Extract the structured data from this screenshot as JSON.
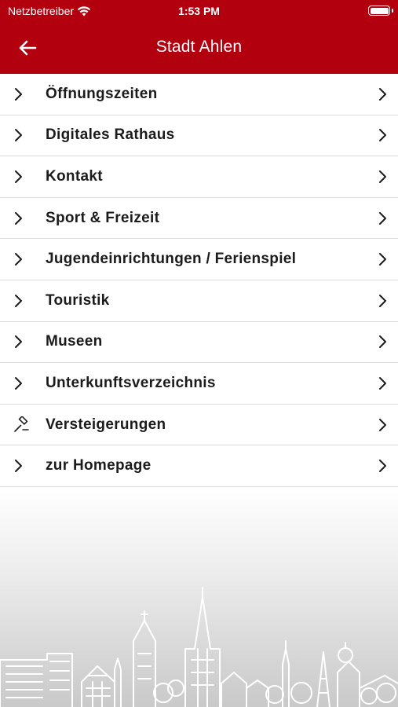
{
  "status_bar": {
    "carrier": "Netzbetreiber",
    "time": "1:53 PM"
  },
  "header": {
    "title": "Stadt Ahlen",
    "background_color": "#b3000f"
  },
  "menu": {
    "items": [
      {
        "label": "Öffnungszeiten",
        "icon": "chevron-right-icon"
      },
      {
        "label": "Digitales Rathaus",
        "icon": "chevron-right-icon"
      },
      {
        "label": "Kontakt",
        "icon": "chevron-right-icon"
      },
      {
        "label": "Sport & Freizeit",
        "icon": "chevron-right-icon"
      },
      {
        "label": "Jugendeinrichtungen / Ferienspiel",
        "icon": "chevron-right-icon"
      },
      {
        "label": "Touristik",
        "icon": "chevron-right-icon"
      },
      {
        "label": "Museen",
        "icon": "chevron-right-icon"
      },
      {
        "label": "Unterkunftsverzeichnis",
        "icon": "chevron-right-icon"
      },
      {
        "label": "Versteigerungen",
        "icon": "gavel-icon"
      },
      {
        "label": "zur Homepage",
        "icon": "chevron-right-icon"
      }
    ]
  }
}
